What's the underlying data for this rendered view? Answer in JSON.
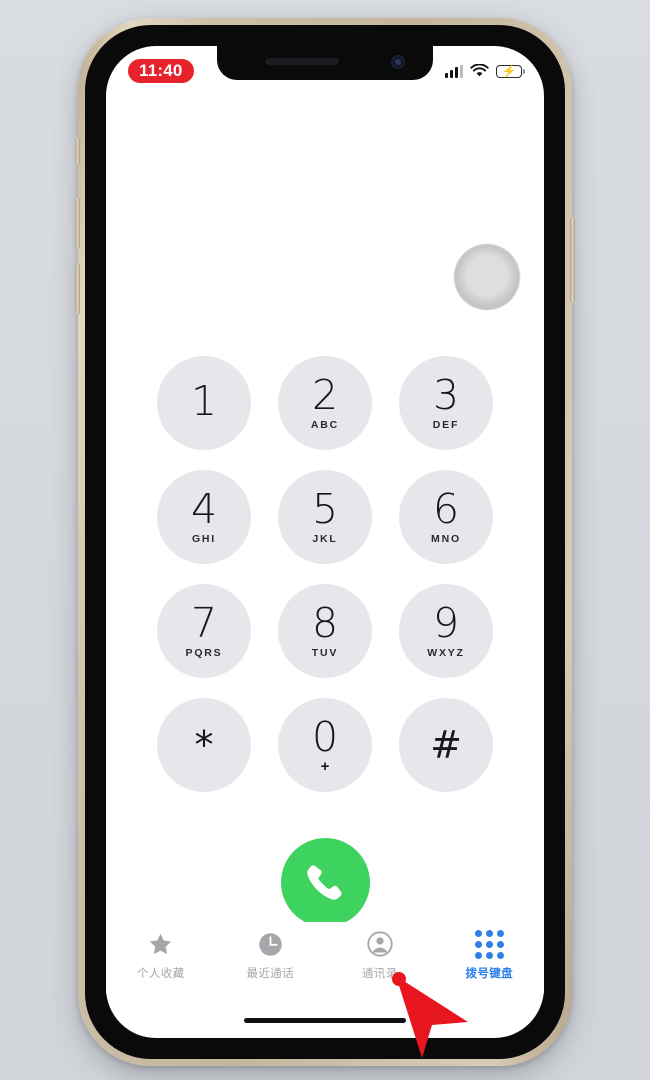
{
  "device": {
    "frame_color": "#cdbfa8",
    "bezel_color": "#0a0a0b",
    "background_color": "#d5d9de"
  },
  "status_bar": {
    "time": "11:40",
    "time_pill_color": "#e8222a",
    "signal_icon": "cellular-signal-icon",
    "wifi_icon": "wifi-icon",
    "battery_icon": "battery-charging-icon",
    "battery_bolt": "⚡"
  },
  "assistive_touch": {
    "name": "assistive-touch-button"
  },
  "dialpad": {
    "rows": [
      [
        {
          "digit": "1",
          "letters": ""
        },
        {
          "digit": "2",
          "letters": "ABC"
        },
        {
          "digit": "3",
          "letters": "DEF"
        }
      ],
      [
        {
          "digit": "4",
          "letters": "GHI"
        },
        {
          "digit": "5",
          "letters": "JKL"
        },
        {
          "digit": "6",
          "letters": "MNO"
        }
      ],
      [
        {
          "digit": "7",
          "letters": "PQRS"
        },
        {
          "digit": "8",
          "letters": "TUV"
        },
        {
          "digit": "9",
          "letters": "WXYZ"
        }
      ],
      [
        {
          "digit": "*",
          "letters": ""
        },
        {
          "digit": "0",
          "letters": "+"
        },
        {
          "digit": "#",
          "letters": ""
        }
      ]
    ],
    "key_color": "#e8e6ea",
    "digit_color": "#18181a"
  },
  "call_button": {
    "label": "call-button",
    "color": "#3ed25e",
    "icon": "phone-handset-icon"
  },
  "tab_bar": {
    "active_color": "#2e7fe8",
    "inactive_color": "#a7a7ab",
    "tabs": [
      {
        "label": "个人收藏",
        "icon": "star-icon",
        "active": false
      },
      {
        "label": "最近通话",
        "icon": "clock-icon",
        "active": false
      },
      {
        "label": "通讯录",
        "icon": "person-circle-icon",
        "active": false
      },
      {
        "label": "拨号键盘",
        "icon": "keypad-grid-icon",
        "active": true
      }
    ]
  },
  "cursor": {
    "name": "red-arrow-pointer",
    "color": "#e8171f",
    "points_to": "通讯录"
  }
}
